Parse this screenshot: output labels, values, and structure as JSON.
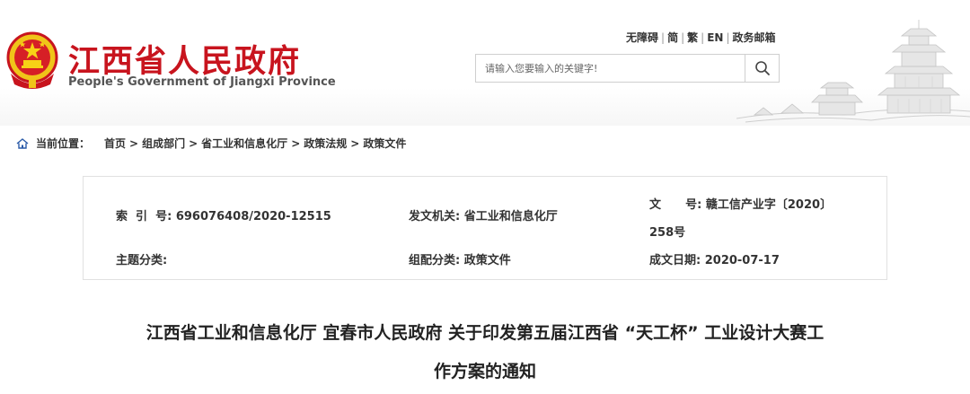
{
  "site": {
    "title": "江西省人民政府",
    "subtitle": "People's Government of Jiangxi Province"
  },
  "top_links": [
    "无障碍",
    "简",
    "繁",
    "EN",
    "政务邮箱"
  ],
  "search": {
    "placeholder": "请输入您要输入的关键字!"
  },
  "breadcrumb": {
    "label": "当前位置：",
    "items": [
      "首页",
      "组成部门",
      "省工业和信息化厅",
      "政策法规",
      "政策文件"
    ]
  },
  "meta": {
    "index_label": "索  引  号:",
    "index_value": "696076408/2020-12515",
    "issuer_label": "发文机关:",
    "issuer_value": "省工业和信息化厅",
    "docno_label": "文      号:",
    "docno_value_line1": "赣工信产业字〔2020〕",
    "docno_value_line2": "258号",
    "topic_label": "主题分类:",
    "topic_value": "",
    "category_label": "组配分类:",
    "category_value": "政策文件",
    "date_label": "成文日期:",
    "date_value": "2020-07-17"
  },
  "document": {
    "title_line1": "江西省工业和信息化厅 宜春市人民政府 关于印发第五届江西省 “天工杯” 工业设计大赛工",
    "title_line2": "作方案的通知"
  },
  "colors": {
    "brand_red": "#c8141e",
    "emblem_gold": "#f0c419"
  },
  "icons": [
    "national-emblem-icon",
    "search-icon",
    "home-icon",
    "pavilion-skyline-icon"
  ]
}
